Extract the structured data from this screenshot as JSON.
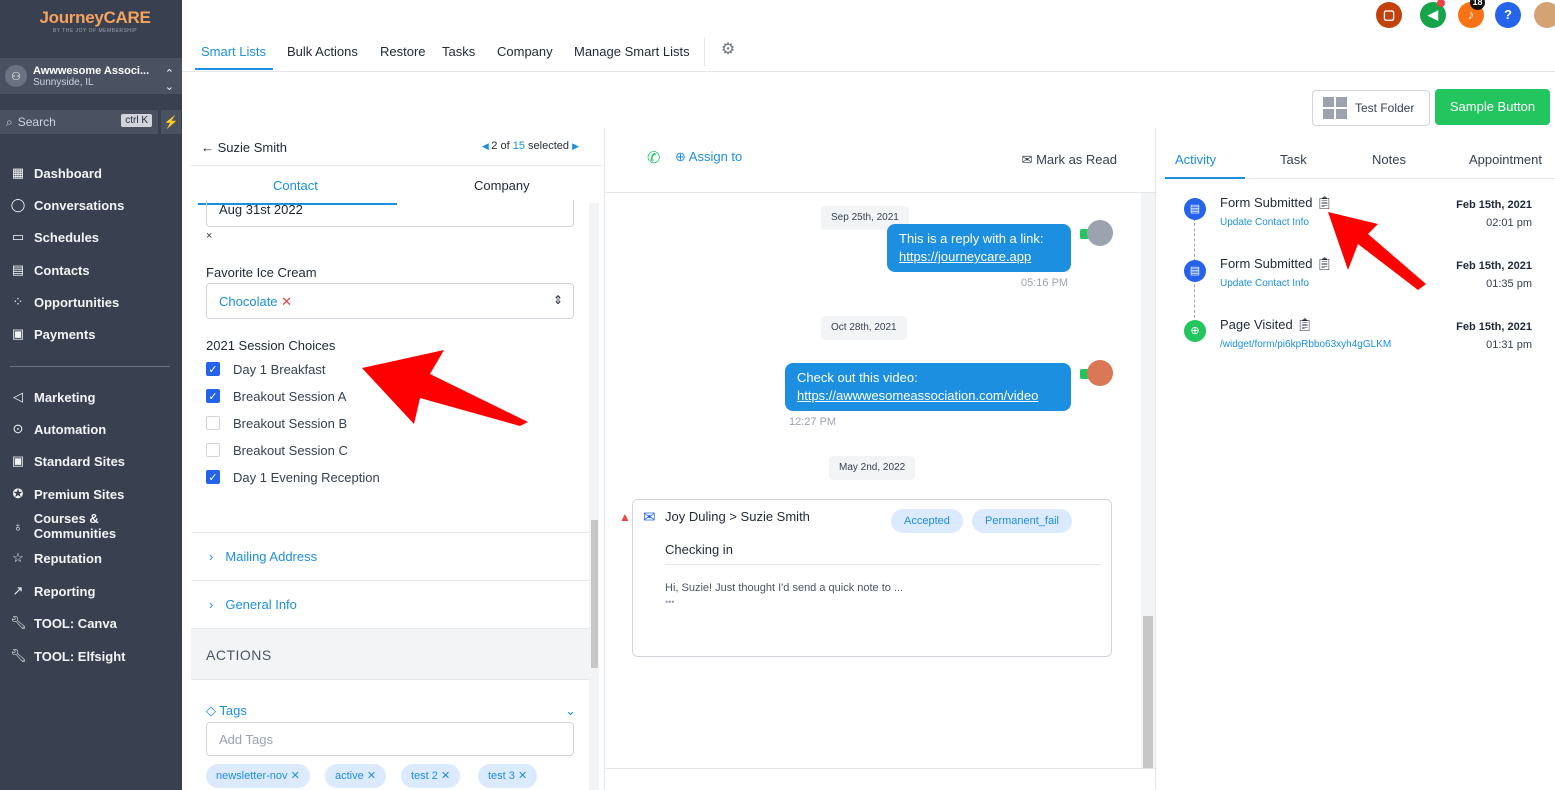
{
  "brand": {
    "logo_text": "JourneyCARE",
    "logo_tagline": "BY THE JOY OF MEMBERSHIP"
  },
  "location": {
    "name": "Awwwesome Associ...",
    "city": "Sunnyside, IL"
  },
  "search": {
    "placeholder": "Search",
    "shortcut": "ctrl K"
  },
  "sidebar": {
    "items": [
      {
        "label": "Dashboard",
        "icon": "dashboard-icon"
      },
      {
        "label": "Conversations",
        "icon": "chat-icon"
      },
      {
        "label": "Schedules",
        "icon": "calendar-icon"
      },
      {
        "label": "Contacts",
        "icon": "contacts-icon"
      },
      {
        "label": "Opportunities",
        "icon": "opportunities-icon"
      },
      {
        "label": "Payments",
        "icon": "payments-icon"
      },
      {
        "label": "Marketing",
        "icon": "send-icon"
      },
      {
        "label": "Automation",
        "icon": "automation-icon"
      },
      {
        "label": "Standard Sites",
        "icon": "site-icon"
      },
      {
        "label": "Premium Sites",
        "icon": "award-icon"
      },
      {
        "label": "Courses & Communities",
        "icon": "courses-icon"
      },
      {
        "label": "Reputation",
        "icon": "star-icon"
      },
      {
        "label": "Reporting",
        "icon": "chart-line-icon"
      },
      {
        "label": "TOOL: Canva",
        "icon": "wrench-icon"
      },
      {
        "label": "TOOL: Elfsight",
        "icon": "wrench-icon"
      }
    ]
  },
  "topnav": {
    "tabs": [
      "Smart Lists",
      "Bulk Actions",
      "Restore",
      "Tasks",
      "Company",
      "Manage Smart Lists"
    ],
    "active": "Smart Lists"
  },
  "notifications": {
    "count": "18"
  },
  "toolbar": {
    "folder_label": "Test Folder",
    "sample_label": "Sample Button"
  },
  "contact": {
    "back_label": "Suzie Smith",
    "pager_prefix": "2 of",
    "pager_count": "15",
    "pager_suffix": "selected",
    "tabs": [
      "Contact",
      "Company"
    ],
    "date_value": "Aug 31st 2022",
    "clear_mark": "×",
    "ice_cream_label": "Favorite Ice Cream",
    "ice_cream_value": "Chocolate",
    "session_label": "2021 Session Choices",
    "sessions": [
      {
        "label": "Day 1 Breakfast",
        "checked": true
      },
      {
        "label": "Breakout Session A",
        "checked": true
      },
      {
        "label": "Breakout Session B",
        "checked": false
      },
      {
        "label": "Breakout Session C",
        "checked": false
      },
      {
        "label": "Day 1 Evening Reception",
        "checked": true
      }
    ],
    "mailing_label": "Mailing Address",
    "general_label": "General Info",
    "actions_label": "ACTIONS",
    "tags_label": "Tags",
    "tags_placeholder": "Add Tags",
    "tags": [
      "newsletter-nov",
      "active",
      "test 2",
      "test 3"
    ]
  },
  "chat": {
    "assign_label": "Assign to",
    "mark_read_label": "Mark as Read",
    "date1": "Sep 25th, 2021",
    "msg1_text": "This is a reply with a link:",
    "msg1_link": "https://journeycare.app",
    "msg1_time": "05:16 PM",
    "date2": "Oct 28th, 2021",
    "msg2_text": "Check out this video:",
    "msg2_link": "https://awwwesomeassociation.com/video",
    "msg2_time": "12:27 PM",
    "date3": "May 2nd, 2022",
    "email_from": "Joy Duling",
    "email_sep": ">",
    "email_to": "Suzie Smith",
    "email_status1": "Accepted",
    "email_status2": "Permanent_fail",
    "email_subject": "Checking in",
    "email_preview": "Hi, Suzie! Just thought I'd send a quick note to ...",
    "email_more": "•••"
  },
  "activity": {
    "tabs": [
      "Activity",
      "Task",
      "Notes",
      "Appointment"
    ],
    "items": [
      {
        "title": "Form Submitted",
        "sub": "Update Contact Info",
        "date": "Feb 15th, 2021",
        "time": "02:01 pm",
        "color": "#2563eb"
      },
      {
        "title": "Form Submitted",
        "sub": "Update Contact Info",
        "date": "Feb 15th, 2021",
        "time": "01:35 pm",
        "color": "#2563eb"
      },
      {
        "title": "Page Visited",
        "sub": "/widget/form/pi6kpRbbo63xyh4gGLKM",
        "date": "Feb 15th, 2021",
        "time": "01:31 pm",
        "color": "#22c55e"
      }
    ]
  },
  "colors": {
    "accent": "#1d8fe1",
    "sidebar": "#394150",
    "success": "#22c55e",
    "annotation": "#ff0000"
  }
}
